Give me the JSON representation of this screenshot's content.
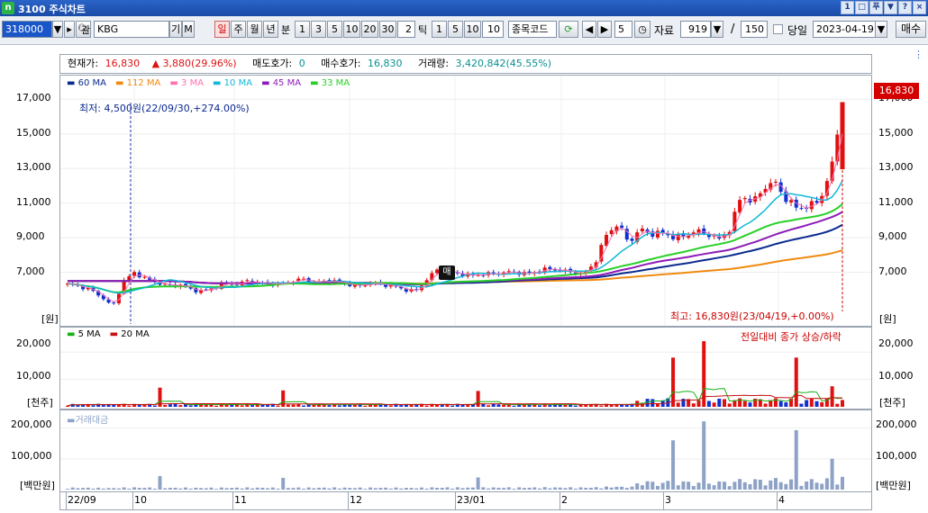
{
  "window": {
    "title": "3100 주식차트",
    "logo": "n",
    "buttons": [
      "1",
      "□",
      "푸",
      "▼",
      "?",
      "×"
    ]
  },
  "toolbar": {
    "code": "318000",
    "type_label": "관",
    "name": "KBG",
    "btn_gi": "기",
    "btn_m": "M",
    "periods": [
      "일",
      "주",
      "월",
      "년",
      "분"
    ],
    "minute_nums": [
      "1",
      "3",
      "5",
      "10",
      "20",
      "30"
    ],
    "n_field": "2",
    "tick_label": "틱",
    "tick_nums": [
      "1",
      "5",
      "10"
    ],
    "tick_field": "10",
    "code_label": "종목코드",
    "step_value": "5",
    "data_label": "자료",
    "data_count": "919",
    "slash": "/",
    "page_size": "150",
    "today_label": "당일",
    "date": "2023-04-19",
    "buy_label": "매수"
  },
  "info": {
    "price_label": "현재가:",
    "price": "16,830",
    "change": "3,880(29.96%)",
    "ask_label": "매도호가:",
    "ask": "0",
    "bid_label": "매수호가:",
    "bid": "16,830",
    "volume_label": "거래량:",
    "volume": "3,420,842(45.55%)"
  },
  "price_panel": {
    "unit": "[원]",
    "ticks": [
      "17,000",
      "15,000",
      "13,000",
      "11,000",
      "9,000",
      "7,000"
    ],
    "current_label": "16,830",
    "low_note": "최저: 4,500원(22/09/30,+274.00%)",
    "high_note": "최고: 16,830원(23/04/19,+0.00%)",
    "signal_badge": "매",
    "ma_legend": [
      {
        "name": "60 MA",
        "color": "#0b2a8f"
      },
      {
        "name": "112 MA",
        "color": "#f08a10"
      },
      {
        "name": "3 MA",
        "color": "#ff6fb0"
      },
      {
        "name": "10 MA",
        "color": "#12b8d6"
      },
      {
        "name": "45 MA",
        "color": "#8e1bb8"
      },
      {
        "name": "33 MA",
        "color": "#26d026"
      }
    ]
  },
  "volume_panel": {
    "unit": "[천주]",
    "ticks": [
      "20,000",
      "10,000"
    ],
    "legend": [
      {
        "name": "5 MA",
        "color": "#16b016"
      },
      {
        "name": "20 MA",
        "color": "#c81010"
      }
    ],
    "note": "전일대비 종가 상승/하락"
  },
  "amount_panel": {
    "unit": "[백만원]",
    "ticks": [
      "200,000",
      "100,000"
    ],
    "legend": "거래대금"
  },
  "x_axis": {
    "labels": [
      "22/09",
      "10",
      "11",
      "12",
      "23/01",
      "2",
      "3",
      "4"
    ]
  },
  "chart_data": {
    "type": "candlestick",
    "ylim": [
      5000,
      18000
    ],
    "price_path": [
      6300,
      6200,
      6000,
      5600,
      5000,
      6500,
      7000,
      6600,
      6400,
      6200,
      6300,
      6000,
      5900,
      6100,
      6400,
      6300,
      6500,
      6400,
      6350,
      6300,
      6500,
      6600,
      6400,
      6500,
      6450,
      6300,
      6200,
      6400,
      6300,
      6200,
      6000,
      5900,
      6600,
      7200,
      7000,
      6900,
      6800,
      6900,
      6900,
      7000,
      7000,
      6900,
      7100,
      7200,
      7100,
      7000,
      6900,
      7600,
      9200,
      9800,
      8700,
      9500,
      9200,
      9300,
      9000,
      9100,
      9400,
      9200,
      8900,
      9500,
      11500,
      11000,
      11900,
      12200,
      11200,
      10700,
      10800,
      11200,
      12900,
      16830
    ],
    "volume_spikes": [
      {
        "at": 0.12,
        "value": 7000
      },
      {
        "at": 0.28,
        "value": 6000
      },
      {
        "at": 0.53,
        "value": 5800
      },
      {
        "at": 0.78,
        "value": 18000
      },
      {
        "at": 0.82,
        "value": 24000
      },
      {
        "at": 0.94,
        "value": 18000
      },
      {
        "at": 0.99,
        "value": 7500
      }
    ]
  }
}
